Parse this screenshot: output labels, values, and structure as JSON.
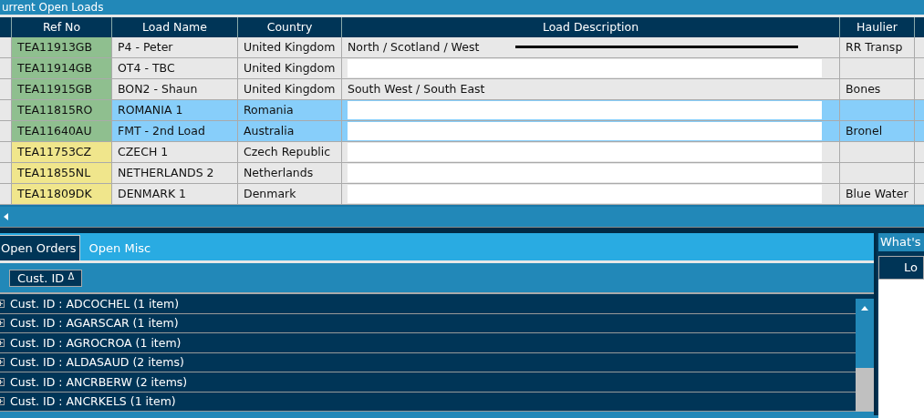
{
  "loads_panel": {
    "title": "urrent Open Loads",
    "columns": [
      "Ref No",
      "Load Name",
      "Country",
      "Load Description",
      "Haulier"
    ],
    "rows": [
      {
        "ref": "TEA11913GB",
        "color": "#8fbf8f",
        "name": "P4 - Peter",
        "country": "United Kingdom",
        "description": "North / Scotland / West",
        "redacted": true,
        "haulier": "RR Transp",
        "selected": false
      },
      {
        "ref": "TEA11914GB",
        "color": "#8fbf8f",
        "name": "OT4 - TBC",
        "country": "United Kingdom",
        "redacted": true,
        "haulier": "",
        "selected": false
      },
      {
        "ref": "TEA11915GB",
        "color": "#8fbf8f",
        "name": "BON2 - Shaun",
        "country": "United Kingdom",
        "description": "South West / South East",
        "redacted": false,
        "haulier": "Bones",
        "selected": false
      },
      {
        "ref": "TEA11815RO",
        "color": "#8fbf8f",
        "name": "ROMANIA 1",
        "country": "Romania",
        "redacted": true,
        "haulier": "",
        "selected": true
      },
      {
        "ref": "TEA11640AU",
        "color": "#8fbf8f",
        "name": "FMT - 2nd Load",
        "country": "Australia",
        "redacted": true,
        "haulier": "Bronel",
        "selected": true
      },
      {
        "ref": "TEA11753CZ",
        "color": "#f0e68c",
        "name": "CZECH 1",
        "country": "Czech Republic",
        "redacted": true,
        "haulier": "",
        "selected": false
      },
      {
        "ref": "TEA11855NL",
        "color": "#f0e68c",
        "name": "NETHERLANDS 2",
        "country": "Netherlands",
        "redacted": true,
        "haulier": "",
        "selected": false
      },
      {
        "ref": "TEA11809DK",
        "color": "#f0e68c",
        "name": "DENMARK 1",
        "country": "Denmark",
        "redacted": true,
        "haulier": "Blue Water",
        "selected": false
      }
    ]
  },
  "tabs": [
    {
      "label": "Open Orders",
      "selected": true
    },
    {
      "label": "Open Misc",
      "selected": false
    }
  ],
  "group_by": {
    "label": "Cust. ID",
    "sort_icon": "Δ"
  },
  "groups": [
    {
      "label": "Cust. ID : ADCOCHEL (1 item)",
      "expanded": false
    },
    {
      "label": "Cust. ID : AGARSCAR (1 item)",
      "expanded": false
    },
    {
      "label": "Cust. ID : AGROCROA (1 item)",
      "expanded": false
    },
    {
      "label": "Cust. ID : ALDASAUD (2 items)",
      "expanded": false
    },
    {
      "label": "Cust. ID : ANCRBERW (2 items)",
      "expanded": false
    },
    {
      "label": "Cust. ID : ANCRKELS (1 item)",
      "expanded": false
    }
  ],
  "side_panel": {
    "title": "What's",
    "column": "Lo"
  }
}
